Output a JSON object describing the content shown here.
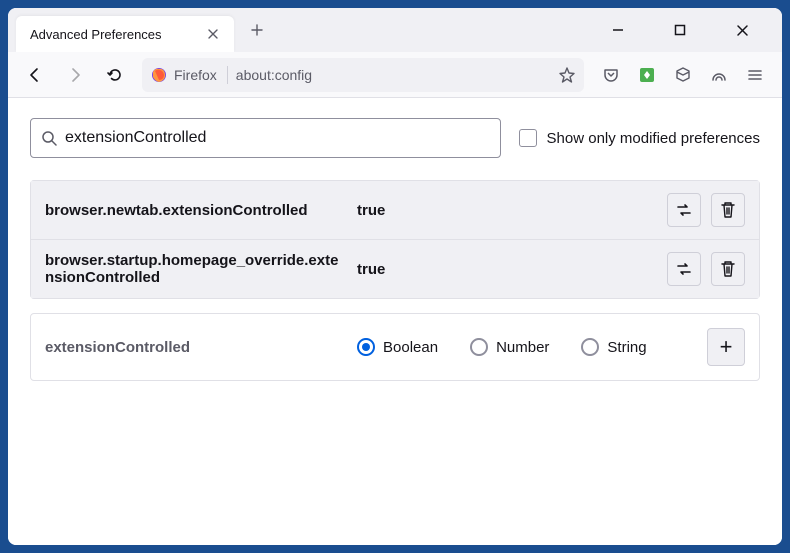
{
  "titlebar": {
    "tab_title": "Advanced Preferences"
  },
  "navbar": {
    "identity_label": "Firefox",
    "url": "about:config"
  },
  "search": {
    "value": "extensionControlled",
    "modified_only_label": "Show only modified preferences"
  },
  "prefs": [
    {
      "name": "browser.newtab.extensionControlled",
      "value": "true"
    },
    {
      "name": "browser.startup.homepage_override.extensionControlled",
      "value": "true"
    }
  ],
  "new_pref": {
    "name": "extensionControlled",
    "types": {
      "boolean": "Boolean",
      "number": "Number",
      "string": "String"
    },
    "selected": "boolean"
  }
}
